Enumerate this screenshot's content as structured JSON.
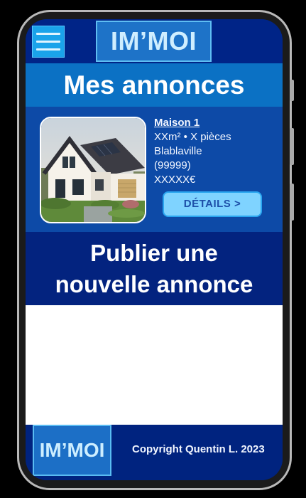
{
  "app": {
    "logo_text": "IM’MOI",
    "menu_icon": "hamburger-menu-icon"
  },
  "page": {
    "section_title": "Mes annonces"
  },
  "listing": {
    "title": "Maison 1",
    "surface_rooms": "XXm² • X pièces",
    "city": "Blablaville",
    "postcode": "(99999)",
    "price": "XXXXX€",
    "details_label": "DÉTAILS >"
  },
  "publish": {
    "line1": "Publier une",
    "line2": "nouvelle annonce"
  },
  "footer": {
    "logo_text": "IM’MOI",
    "copyright": "Copyright Quentin L. 2023"
  },
  "colors": {
    "primary_dark": "#00237f",
    "primary_mid": "#0b71c4",
    "accent_light": "#7fd3ff"
  }
}
